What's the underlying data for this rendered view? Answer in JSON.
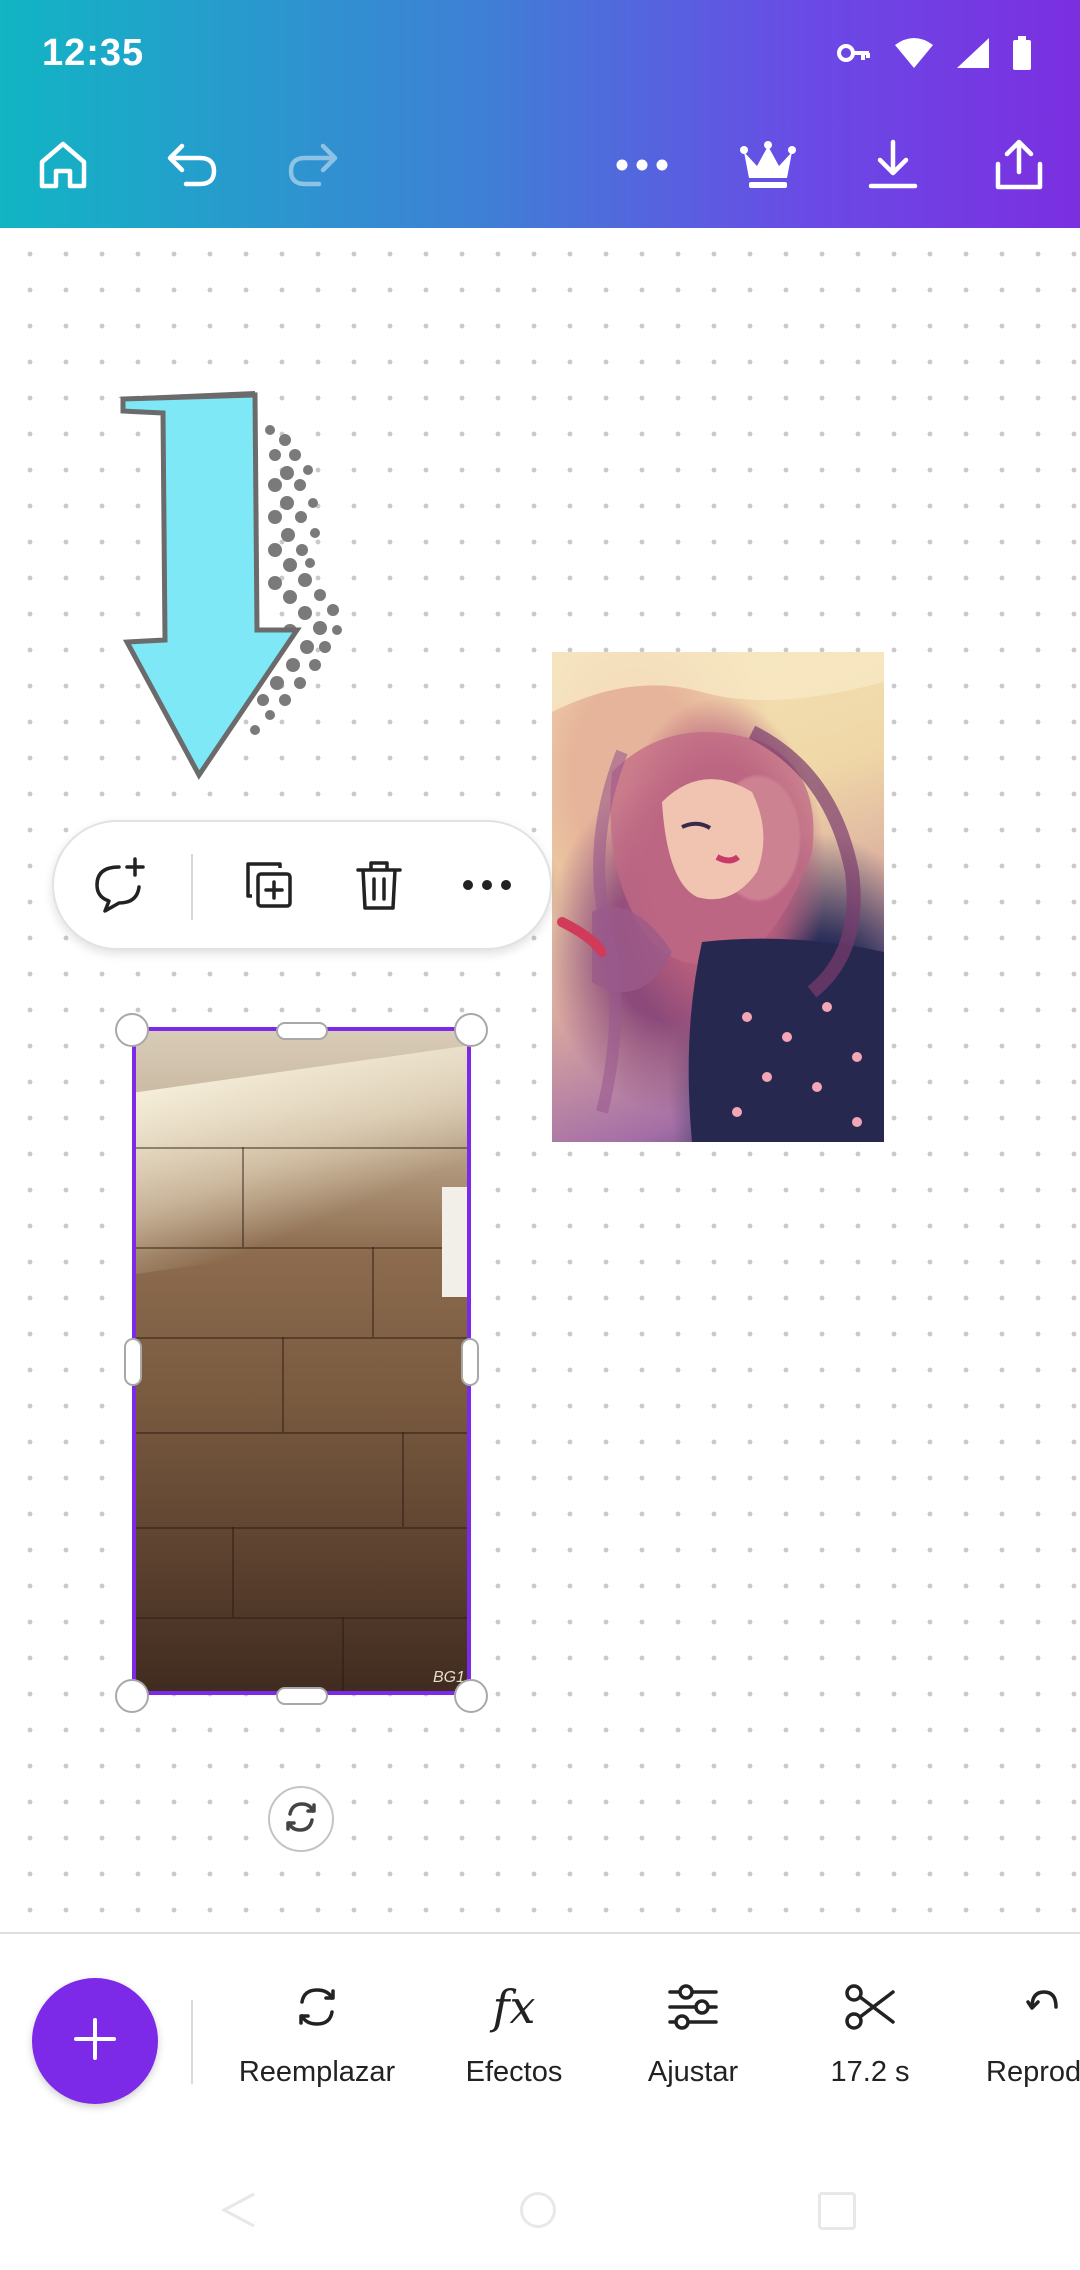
{
  "status_bar": {
    "time": "12:35",
    "icons": [
      "vpn-key-icon",
      "wifi-icon",
      "signal-icon",
      "battery-icon"
    ]
  },
  "toolbar": {
    "items": [
      "home-icon",
      "undo-icon",
      "redo-icon",
      "more-icon",
      "premium-crown-icon",
      "download-icon",
      "share-icon"
    ],
    "redo_enabled": false
  },
  "canvas": {
    "elements": [
      {
        "name": "arrow-graphic",
        "kind": "graphic",
        "colors": {
          "fill": "#7fe8f6",
          "outline": "#6b6b6b",
          "dots": "#7a7a7a"
        }
      },
      {
        "name": "person-photo",
        "kind": "image"
      },
      {
        "name": "floor-video",
        "kind": "video",
        "selected": true,
        "watermark": "BG1"
      }
    ],
    "selection_color": "#7d2ae8"
  },
  "context_menu": {
    "items": [
      "add-comment-icon",
      "duplicate-icon",
      "delete-icon",
      "more-options-icon"
    ]
  },
  "bottom_toolbar": {
    "add_button": "plus-icon",
    "add_button_color": "#7d2ae8",
    "tools": [
      {
        "icon": "replace-icon",
        "label": "Reemplazar"
      },
      {
        "icon": "effects-fx-icon",
        "label": "Efectos"
      },
      {
        "icon": "adjust-sliders-icon",
        "label": "Ajustar"
      },
      {
        "icon": "scissors-icon",
        "label": "17.2 s"
      },
      {
        "icon": "playback-icon",
        "label": "Reprod"
      }
    ]
  },
  "nav_bar": {
    "items": [
      "back-icon",
      "home-circle-icon",
      "recents-icon"
    ]
  }
}
